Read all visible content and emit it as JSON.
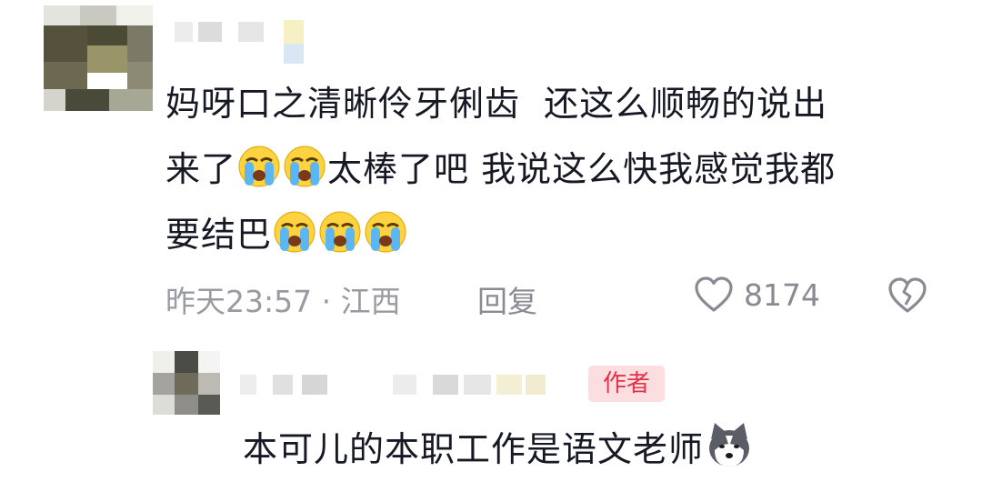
{
  "comment": {
    "line1": "妈呀口之清晰伶牙俐齿  还这么顺畅的说出",
    "line2_a": "来了",
    "line2_b": "太棒了吧 我说这么快我感觉我都",
    "line3_a": "要结巴",
    "emoji_icon": "loudly-crying-face-icon",
    "timestamp": "昨天23:57",
    "separator": " · ",
    "location": "江西",
    "reply_label": "回复",
    "like_count": "8174",
    "like_icon": "heart-outline-icon",
    "dislike_icon": "broken-heart-icon"
  },
  "reply": {
    "badge": "作者",
    "text": "本可儿的本职工作是语文老师",
    "emoji_icon": "husky-dog-face-icon"
  },
  "colors": {
    "text": "#161823",
    "meta": "#9a9aa2",
    "badge_bg": "#fcdde0",
    "badge_text": "#e1344c"
  }
}
